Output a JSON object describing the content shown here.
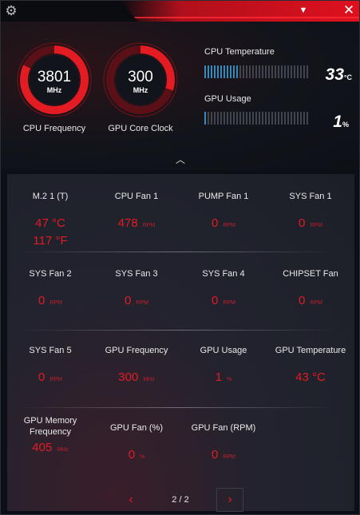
{
  "icons": {
    "settings": "gear-icon",
    "dropdown": "triangle-down-icon",
    "close": "close-icon",
    "collapse": "chevron-up-icon",
    "prev": "chevron-left-icon",
    "next": "chevron-right-icon"
  },
  "glyphs": {
    "settings": "⚙",
    "dropdown": "▼",
    "close": "✕",
    "collapse": "︿",
    "prev": "‹",
    "next": "›"
  },
  "colors": {
    "accent": "#e31b23",
    "bar_fill": "#3aa0d8",
    "gauge_track": "#5a1016"
  },
  "gauges": [
    {
      "value": "3801",
      "unit": "MHz",
      "label": "CPU Frequency",
      "fill_fraction": 0.82
    },
    {
      "value": "300",
      "unit": "MHz",
      "label": "GPU Core Clock",
      "fill_fraction": 0.3
    }
  ],
  "metrics": [
    {
      "label": "CPU Temperature",
      "value": "33",
      "unit": "°C",
      "bar_fraction": 0.33
    },
    {
      "label": "GPU Usage",
      "value": "1",
      "unit": "%",
      "bar_fraction": 0.01
    }
  ],
  "sensors": [
    {
      "label": "M.2 1 (T)",
      "values": [
        {
          "v": "47 °C",
          "u": ""
        },
        {
          "v": "117 °F",
          "u": ""
        }
      ]
    },
    {
      "label": "CPU Fan 1",
      "values": [
        {
          "v": "478",
          "u": "RPM"
        }
      ]
    },
    {
      "label": "PUMP Fan 1",
      "values": [
        {
          "v": "0",
          "u": "RPM"
        }
      ]
    },
    {
      "label": "SYS Fan 1",
      "values": [
        {
          "v": "0",
          "u": "RPM"
        }
      ]
    },
    {
      "label": "SYS Fan 2",
      "values": [
        {
          "v": "0",
          "u": "RPM"
        }
      ]
    },
    {
      "label": "SYS Fan 3",
      "values": [
        {
          "v": "0",
          "u": "RPM"
        }
      ]
    },
    {
      "label": "SYS Fan 4",
      "values": [
        {
          "v": "0",
          "u": "RPM"
        }
      ]
    },
    {
      "label": "CHIPSET Fan",
      "values": [
        {
          "v": "0",
          "u": "RPM"
        }
      ]
    },
    {
      "label": "SYS Fan 5",
      "values": [
        {
          "v": "0",
          "u": "RPM"
        }
      ]
    },
    {
      "label": "GPU Frequency",
      "values": [
        {
          "v": "300",
          "u": "MHz"
        }
      ]
    },
    {
      "label": "GPU Usage",
      "values": [
        {
          "v": "1",
          "u": "%"
        }
      ]
    },
    {
      "label": "GPU Temperature",
      "values": [
        {
          "v": "43 °C",
          "u": ""
        }
      ]
    },
    {
      "label": "GPU Memory Frequency",
      "values": [
        {
          "v": "405",
          "u": "MHz"
        }
      ]
    },
    {
      "label": "GPU Fan (%)",
      "values": [
        {
          "v": "0",
          "u": "%"
        }
      ]
    },
    {
      "label": "GPU Fan (RPM)",
      "values": [
        {
          "v": "0",
          "u": "RPM"
        }
      ]
    }
  ],
  "pager": {
    "text": "2 / 2"
  }
}
